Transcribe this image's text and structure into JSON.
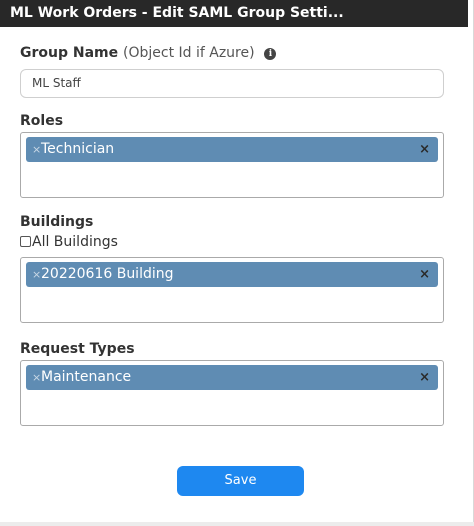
{
  "dialog": {
    "title": "ML Work Orders - Edit SAML Group Setti..."
  },
  "backdrop": {
    "close_glyph": "×"
  },
  "group_name": {
    "label": "Group Name",
    "hint": "(Object Id if Azure)",
    "info_glyph": "i",
    "value": "ML Staff"
  },
  "roles": {
    "label": "Roles",
    "selected": [
      "Technician"
    ]
  },
  "buildings": {
    "label": "Buildings",
    "all_buildings_label": "All Buildings",
    "all_buildings_checked": false,
    "selected": [
      "20220616 Building"
    ]
  },
  "request_types": {
    "label": "Request Types",
    "selected": [
      "Maintenance"
    ]
  },
  "chip": {
    "remove_glyph": "×",
    "clear_glyph": "×"
  },
  "footer": {
    "save_label": "Save"
  },
  "colors": {
    "titlebar": "#282828",
    "chip": "#5f8cb3",
    "primary_button": "#1e88f0"
  },
  "icons": [
    "info-icon",
    "chip-remove-icon",
    "clear-selection-icon",
    "close-icon"
  ]
}
